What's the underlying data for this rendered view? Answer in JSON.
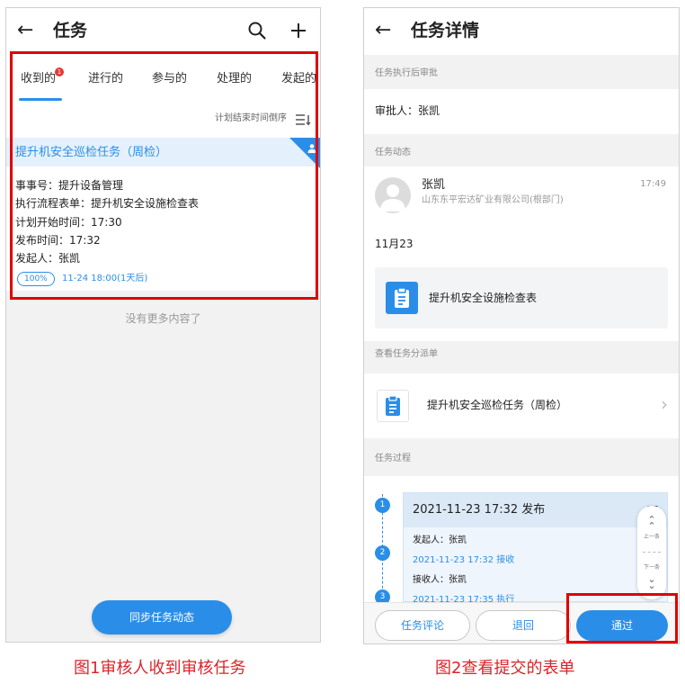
{
  "left_screen": {
    "nav": {
      "title": "任务"
    },
    "tabs": [
      {
        "label": "收到的",
        "badge": "1",
        "active": true
      },
      {
        "label": "进行的"
      },
      {
        "label": "参与的"
      },
      {
        "label": "处理的"
      },
      {
        "label": "发起的"
      }
    ],
    "sort_label": "计划结束时间倒序",
    "task": {
      "title": "提升机安全巡检任务（周检）",
      "matter": "事事号：提升设备管理",
      "flow_form": "执行流程表单：提升机安全设施检查表",
      "plan_start": "计划开始时间：17:30",
      "publish_time": "发布时间：17:32",
      "initiator": "发起人：张凯",
      "progress": "100%",
      "due": "11-24  18:00(1天后)"
    },
    "no_more": "没有更多内容了",
    "sync_button": "同步任务动态"
  },
  "right_screen": {
    "nav": {
      "title": "任务详情"
    },
    "approval_header": "任务执行后审批",
    "approver": "审批人：张凯",
    "activity_header": "任务动态",
    "activity": {
      "name": "张凯",
      "company": "山东东平宏达矿业有限公司(根部门)",
      "time": "17:49",
      "date": "11月23",
      "form_name": "提升机安全设施检查表"
    },
    "dispatch_header": "查看任务分派单",
    "dispatch_name": "提升机安全巡检任务（周检）",
    "process_header": "任务过程",
    "process": {
      "head": "2021-11-23  17:32  发布",
      "initiator": "发起人：张凯",
      "receive": "2021-11-23  17:32  接收",
      "receiver": "接收人：张凯",
      "execute": "2021-11-23  17:35  执行",
      "steps": [
        "1",
        "2",
        "3"
      ]
    },
    "pager": {
      "prev": "上一条",
      "next": "下一条"
    },
    "buttons": {
      "comment": "任务评论",
      "return": "退回",
      "pass": "通过"
    }
  },
  "captions": {
    "left": "图1审核人收到审核任务",
    "right": "图2查看提交的表单"
  },
  "colors": {
    "accent": "#2a8ee8",
    "highlight_box": "#e00000",
    "caption": "#d9252a"
  }
}
